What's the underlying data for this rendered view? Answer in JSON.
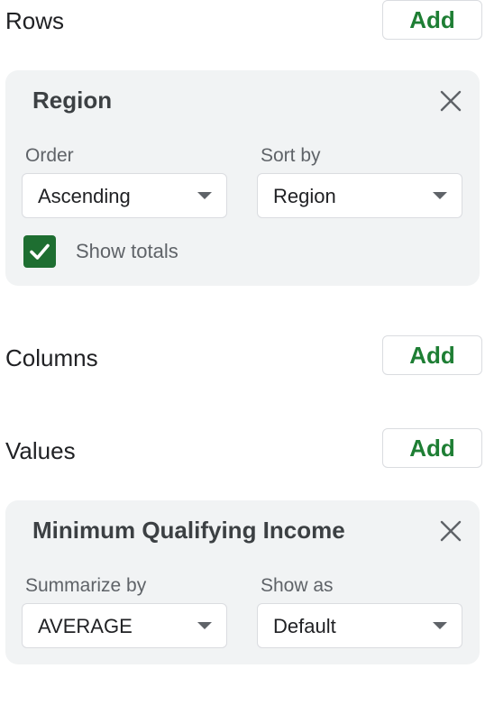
{
  "rows": {
    "heading": "Rows",
    "add_label": "Add",
    "card": {
      "title": "Region",
      "order_label": "Order",
      "order_value": "Ascending",
      "sortby_label": "Sort by",
      "sortby_value": "Region",
      "show_totals_label": "Show totals",
      "show_totals_checked": true
    }
  },
  "columns": {
    "heading": "Columns",
    "add_label": "Add"
  },
  "values": {
    "heading": "Values",
    "add_label": "Add",
    "card": {
      "title": "Minimum Qualifying Income",
      "summarize_label": "Summarize by",
      "summarize_value": "AVERAGE",
      "showas_label": "Show as",
      "showas_value": "Default"
    }
  },
  "colors": {
    "accent_green": "#1e7e34",
    "checkbox_green": "#1e6e31",
    "card_bg": "#f1f3f4"
  },
  "icons": {
    "close": "close-icon",
    "dropdown": "chevron-down-icon",
    "check": "check-icon"
  }
}
